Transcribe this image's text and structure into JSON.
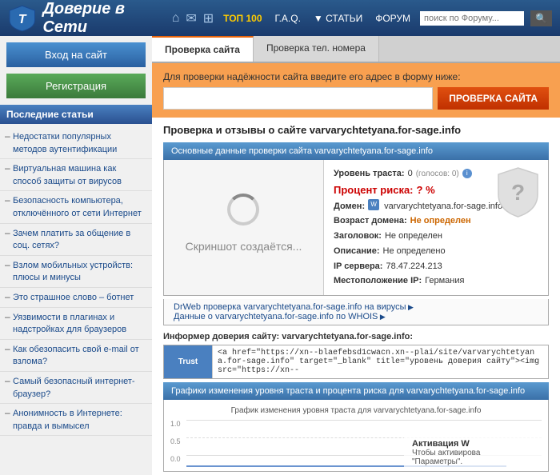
{
  "header": {
    "title": "Доверие в Сети",
    "logo_letter": "T",
    "nav": {
      "home_icon": "⌂",
      "mail_icon": "✉",
      "grid_icon": "⊞",
      "top100": "ТОП 100",
      "faq": "Г.А.Q.",
      "articles": "▼ СТАТЬИ",
      "forum": "ФОРУМ",
      "search_placeholder": "поиск по Форуму...",
      "search_icon": "🔍"
    }
  },
  "sidebar": {
    "login_btn": "Вход на сайт",
    "register_btn": "Регистрация",
    "recent_title": "Последние статьи",
    "articles": [
      "Недостатки популярных методов аутентификации",
      "Виртуальная машина как способ защиты от вирусов",
      "Безопасность компьютера, отключённого от сети Интернет",
      "Зачем платить за общение в соц. сетях?",
      "Взлом мобильных устройств: плюсы и минусы",
      "Это страшное слово – ботнет",
      "Уязвимости в плагинах и надстройках для браузеров",
      "Как обезопасить свой e-mail от взлома?",
      "Самый безопасный интернет-браузер?",
      "Анонимность в Интернете: правда и вымысел"
    ]
  },
  "tabs": {
    "check_site": "Проверка сайта",
    "check_phone": "Проверка тел. номера"
  },
  "check_form": {
    "label": "Для проверки надёжности сайта введите его адрес в форму ниже:",
    "placeholder": "",
    "btn_label": "ПРОВЕРКА САЙТА"
  },
  "site_check": {
    "intro": "Проверка и отзывы о сайте varvarychtetyana.for-sage.info",
    "section_header": "Основные данные проверки сайта varvarychtetyana.for-sage.info",
    "screenshot_text": "Скриншот создаётся...",
    "trust_level_label": "Уровень траста:",
    "trust_level_value": "0",
    "trust_votes": "(голосов: 0)",
    "percent_label": "Процент риска:",
    "percent_value": "? %",
    "domain_label": "Домен:",
    "domain_value": "varvarychtetyana.for-sage.info",
    "age_label": "Возраст домена:",
    "age_value": "Не определен",
    "title_label": "Заголовок:",
    "title_value": "Не определен",
    "desc_label": "Описание:",
    "desc_value": "Не определено",
    "ip_label": "IP сервера:",
    "ip_value": "78.47.224.213",
    "location_label": "Местоположение IP:",
    "location_value": "Германия",
    "link1": "DrWeb проверка varvarychtetyana.for-sage.info на вирусы",
    "link2": "Данные о varvarychtetyana.for-sage.info по WHOIS"
  },
  "informer": {
    "header": "Информер доверия сайту: varvarychtetyana.for-sage.info:",
    "trust_text": "Trust",
    "code": "<a href=\"https://xn--blaefebsd1cwacn.xn--plai/site/varvarychtetyana.for-sage.info\" target=\"_blank\" title=\"уровень доверия сайту\"><img src=\"https://xn--"
  },
  "graph": {
    "header": "Графики изменения уровня траста и процента риска для varvarychtetyana.for-sage.info",
    "title": "График изменения уровня траста для varvarychtetyana.for-sage.info",
    "y_labels": [
      "1.0",
      "0.5",
      "0.0"
    ]
  },
  "windows_activation": {
    "title": "Активация W",
    "line1": "Чтобы активирова",
    "line2": "\"Параметры\"."
  }
}
